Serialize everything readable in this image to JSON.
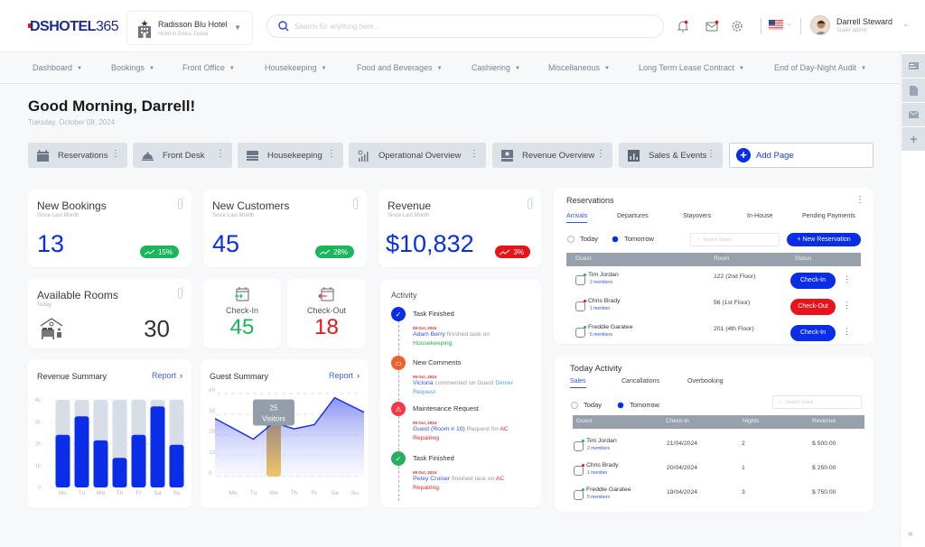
{
  "header": {
    "logo": {
      "ds": "DS",
      "hotel": "HOTEL",
      "num": "365"
    },
    "hotel": {
      "name": "Radisson Blu Hotel",
      "location": "Hotel in Deira, Dubai"
    },
    "search_placeholder": "Search for anything here...",
    "user": {
      "name": "Darrell Steward",
      "role": "Super admin"
    },
    "icons": [
      "bell-icon",
      "mail-icon",
      "gear-icon",
      "us-flag-icon"
    ]
  },
  "nav": {
    "items": [
      "Dashboard",
      "Bookings",
      "Front Office",
      "Housekeeping",
      "Food and Beverages",
      "Cashiering",
      "Miscellaneous",
      "Long Term Lease Contract",
      "End of Day-Night Audit"
    ]
  },
  "greeting": {
    "title": "Good Morning, Darrell!",
    "date": "Tuesday, October 08, 2024"
  },
  "page_tabs": [
    {
      "label": "Reservations",
      "icon": "calendar-icon"
    },
    {
      "label": "Front Desk",
      "icon": "service-bell-icon"
    },
    {
      "label": "Housekeeping",
      "icon": "bed-icon"
    },
    {
      "label": "Operational Overview",
      "icon": "operations-chart-icon"
    },
    {
      "label": "Revenue Overview",
      "icon": "revenue-icon"
    },
    {
      "label": "Sales & Events",
      "icon": "bar-chart-icon"
    }
  ],
  "add_page": "Add Page",
  "stats": {
    "new_bookings": {
      "title": "New Bookings",
      "sub": "Since Last Month",
      "value": "13",
      "change": "15%",
      "trend": "up"
    },
    "new_customers": {
      "title": "New Customers",
      "sub": "Since Last Month",
      "value": "45",
      "change": "28%",
      "trend": "up"
    },
    "revenue": {
      "title": "Revenue",
      "sub": "Since Last Month",
      "value": "$10,832",
      "change": "3%",
      "trend": "down"
    },
    "available_rooms": {
      "title": "Available Rooms",
      "sub": "Today",
      "value": "30"
    },
    "check_in": {
      "title": "Check-In",
      "value": "45"
    },
    "check_out": {
      "title": "Check-Out",
      "value": "18"
    }
  },
  "colors": {
    "accent": "#0a2ee8",
    "green": "#1bb55c",
    "red": "#e8141b",
    "muted_bar": "#d6dde6",
    "tooltip": "#939ea8",
    "highlight": "#f0c468"
  },
  "revenue_summary": {
    "title": "Revenue Summary",
    "report": "Report"
  },
  "guest_summary": {
    "title": "Guest Summary",
    "report": "Report",
    "tooltip_value": "25",
    "tooltip_label": "Visitors"
  },
  "chart_data": [
    {
      "type": "bar",
      "title": "Revenue Summary",
      "categories": [
        "Mo",
        "Tu",
        "We",
        "Th",
        "Fr",
        "Sa",
        "Su"
      ],
      "values": [
        2400,
        3250,
        2150,
        1350,
        2400,
        3700,
        1950
      ],
      "max_values": [
        4000,
        4000,
        4000,
        4000,
        4000,
        4000,
        4000
      ],
      "yticks": [
        "0",
        "1k",
        "2k",
        "3k",
        "4k"
      ],
      "ylim": [
        0,
        4000
      ],
      "xlabel": "",
      "ylabel": "",
      "grid": true
    },
    {
      "type": "area",
      "title": "Guest Summary",
      "categories": [
        "Mo",
        "Tu",
        "We",
        "Th",
        "Fr",
        "Sa",
        "Su"
      ],
      "x_start_value": 28,
      "values": [
        18,
        26,
        23,
        25,
        38,
        31
      ],
      "series": [
        {
          "name": "Visitors",
          "values": [
            28,
            18,
            26,
            23,
            25,
            38,
            31
          ]
        }
      ],
      "highlight": {
        "category": "We",
        "value": 25,
        "label": "Visitors"
      },
      "yticks": [
        "0",
        "10",
        "20",
        "30",
        "40"
      ],
      "ylim": [
        0,
        40
      ],
      "xlabel": "",
      "ylabel": "",
      "grid": true
    }
  ],
  "activity": {
    "title": "Activity",
    "items": [
      {
        "head": "Task Finished",
        "date": "09 Oct, 2024",
        "kind": "task-done",
        "parts": [
          [
            "lnk",
            "Adam Berry"
          ],
          [
            "",
            " finished task on "
          ],
          [
            "grn",
            "Housekeeping"
          ]
        ]
      },
      {
        "head": "New Comments",
        "date": "09 Oct, 2024",
        "kind": "comment",
        "parts": [
          [
            "lnk",
            "Victoria"
          ],
          [
            "",
            " commented on Guest "
          ],
          [
            "cyan",
            "Dinner Request"
          ]
        ]
      },
      {
        "head": "Maintenance Request",
        "date": "09 Oct, 2024",
        "kind": "warning",
        "parts": [
          [
            "lnk",
            "Guest (Room # 10)"
          ],
          [
            "",
            " Request for "
          ],
          [
            "red",
            "AC Repairing"
          ]
        ]
      },
      {
        "head": "Task Finished",
        "date": "09 Oct, 2024",
        "kind": "task-done-green",
        "parts": [
          [
            "lnk",
            "Petey Cruiser"
          ],
          [
            "",
            " finished task on "
          ],
          [
            "red",
            "AC Repairing"
          ]
        ]
      }
    ]
  },
  "reservations": {
    "title": "Reservations",
    "tabs": [
      "Arrivals",
      "Departures",
      "Stayovers",
      "In-House",
      "Pending Payments"
    ],
    "active_tab": "Arrivals",
    "radios": [
      "Today",
      "Tomorrow"
    ],
    "selected": "Tomorrow",
    "search_placeholder": "Search Guest",
    "new_button": "+ New Reservation",
    "columns": [
      "Guest",
      "Room",
      "Status"
    ],
    "rows": [
      {
        "guest": "Tim Jordan",
        "members": "2 members",
        "room": "122 (2nd Floor)",
        "status": "Check-In",
        "dot": "green"
      },
      {
        "guest": "Chris Brady",
        "members": "1 member",
        "room": "56 (1st Floor)",
        "status": "Check-Out",
        "dot": "red"
      },
      {
        "guest": "Freddie Garatee",
        "members": "5 members",
        "room": "201 (4th Floor)",
        "status": "Check-In",
        "dot": "green"
      }
    ]
  },
  "today_activity": {
    "title": "Today Activity",
    "tabs": [
      "Sales",
      "Cancallations",
      "Overbooking"
    ],
    "active_tab": "Sales",
    "radios": [
      "Today",
      "Tomorrow"
    ],
    "selected": "Tomorrow",
    "search_placeholder": "Search Guest",
    "columns": [
      "Guest",
      "Check-in",
      "Nights",
      "Revenue"
    ],
    "rows": [
      {
        "guest": "Tim Jordan",
        "members": "2 members",
        "checkin": "21/04/2024",
        "nights": "2",
        "revenue": "$ 500.00",
        "dot": "green"
      },
      {
        "guest": "Chris Brady",
        "members": "1 member",
        "checkin": "20/04/2024",
        "nights": "1",
        "revenue": "$ 250.00",
        "dot": "red"
      },
      {
        "guest": "Freddie Garatee",
        "members": "5 members",
        "checkin": "19/04/2024",
        "nights": "3",
        "revenue": "$ 750.00",
        "dot": "green"
      }
    ]
  },
  "rail": {
    "icons": [
      "id-card-icon",
      "document-icon",
      "envelope-icon",
      "plus-icon"
    ],
    "collapse": "«"
  }
}
